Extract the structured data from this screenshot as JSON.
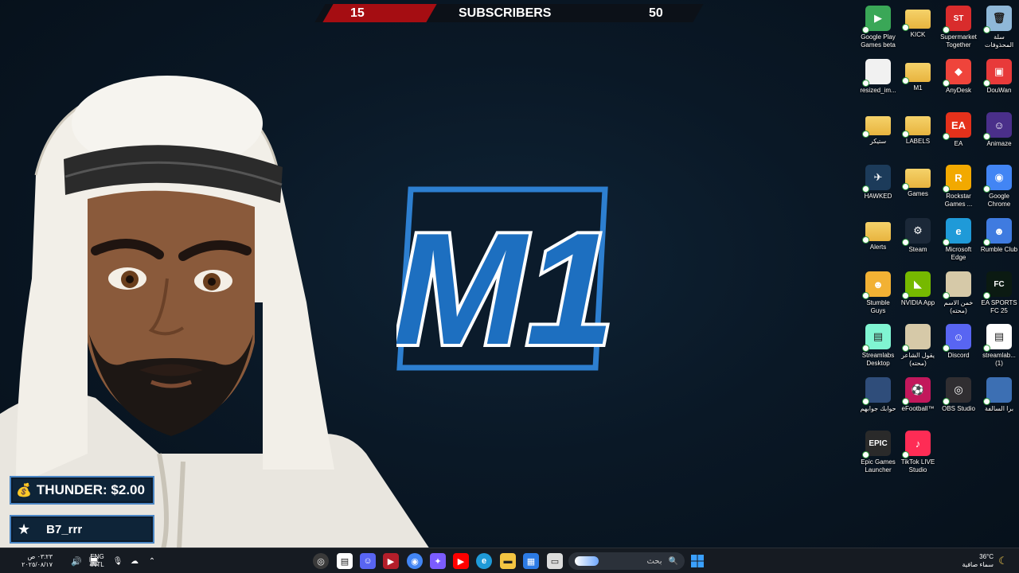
{
  "subscriber_bar": {
    "left_count": "15",
    "label": "SUBSCRIBERS",
    "right_count": "50"
  },
  "logo_text": "M1",
  "donation": {
    "text": "THUNDER: $2.00",
    "icon": "money-bag-icon"
  },
  "follower": {
    "text": "B7_rrr",
    "icon": "star-icon"
  },
  "desktop_icons": [
    {
      "label": "Google Play Games beta",
      "icon": "google-play-games-icon",
      "color": "#3aa757"
    },
    {
      "label": "KICK",
      "icon": "folder-icon",
      "color": "#e8b43f"
    },
    {
      "label": "Supermarket Together",
      "icon": "supermarket-together-icon",
      "color": "#d92c2c"
    },
    {
      "label": "سلة المحذوفات",
      "icon": "recycle-bin-icon",
      "color": "#8fb8d8"
    },
    {
      "label": "resized_im...",
      "icon": "image-file-icon",
      "color": "#f1f1f1"
    },
    {
      "label": "M1",
      "icon": "folder-icon",
      "color": "#e8b43f"
    },
    {
      "label": "AnyDesk",
      "icon": "anydesk-icon",
      "color": "#ef443b"
    },
    {
      "label": "DouWan",
      "icon": "douwan-icon",
      "color": "#e83a3a"
    },
    {
      "label": "ستيكر",
      "icon": "folder-icon",
      "color": "#e8b43f"
    },
    {
      "label": "LABELS",
      "icon": "folder-icon",
      "color": "#e8b43f"
    },
    {
      "label": "EA",
      "icon": "ea-icon",
      "color": "#e5311b"
    },
    {
      "label": "Animaze",
      "icon": "animaze-icon",
      "color": "#4a2f8a"
    },
    {
      "label": "HAWKED",
      "icon": "hawked-icon",
      "color": "#1c3b5a"
    },
    {
      "label": "Games",
      "icon": "folder-icon",
      "color": "#e8b43f"
    },
    {
      "label": "Rockstar Games ...",
      "icon": "rockstar-icon",
      "color": "#f2a900"
    },
    {
      "label": "Google Chrome",
      "icon": "chrome-icon",
      "color": "#4285f4"
    },
    {
      "label": "Alerts",
      "icon": "folder-icon",
      "color": "#e8b43f"
    },
    {
      "label": "Steam",
      "icon": "steam-icon",
      "color": "#1b2838"
    },
    {
      "label": "Microsoft Edge",
      "icon": "edge-icon",
      "color": "#1f9ad8"
    },
    {
      "label": "Rumble Club",
      "icon": "rumble-club-icon",
      "color": "#3f7be0"
    },
    {
      "label": "Stumble Guys",
      "icon": "stumble-guys-icon",
      "color": "#f2b134"
    },
    {
      "label": "NVIDIA App",
      "icon": "nvidia-icon",
      "color": "#76b900"
    },
    {
      "label": "خمن الاسم (محته)",
      "icon": "image-file-icon",
      "color": "#d6c9a8"
    },
    {
      "label": "EA SPORTS FC 25",
      "icon": "fc25-icon",
      "color": "#0b1a12"
    },
    {
      "label": "Streamlabs Desktop",
      "icon": "streamlabs-icon",
      "color": "#80f5d2"
    },
    {
      "label": "يقول الشاعر (محته)",
      "icon": "image-file-icon",
      "color": "#d6c9a8"
    },
    {
      "label": "Discord",
      "icon": "discord-icon",
      "color": "#5865f2"
    },
    {
      "label": "streamlab... (1)",
      "icon": "streamlabs-icon",
      "color": "#ffffff"
    },
    {
      "label": "حوابك جوابهم",
      "icon": "image-file-icon",
      "color": "#2f4d7a"
    },
    {
      "label": "eFootball™",
      "icon": "efootball-icon",
      "color": "#c2185b"
    },
    {
      "label": "OBS Studio",
      "icon": "obs-icon",
      "color": "#302e31"
    },
    {
      "label": "برا السالفة",
      "icon": "image-file-icon",
      "color": "#3c6fb3"
    },
    {
      "label": "Epic Games Launcher",
      "icon": "epic-games-icon",
      "color": "#2a2a2a"
    },
    {
      "label": "TikTok LIVE Studio",
      "icon": "tiktok-icon",
      "color": "#fe2c55"
    }
  ],
  "taskbar": {
    "clock_time": "٠٣:٢٣ ص",
    "clock_date": "٢٠٢٥/٠٨/١٧",
    "language": "ENG",
    "layout": "INTL",
    "search_placeholder": "بحث",
    "weather_temp": "36°C",
    "weather_desc": "سماء صافية",
    "pinned": [
      {
        "icon": "obs-taskbar-icon",
        "color": "#3a3a3a"
      },
      {
        "icon": "streamlabs-taskbar-icon",
        "color": "#ffffff"
      },
      {
        "icon": "discord-taskbar-icon",
        "color": "#5865f2"
      },
      {
        "icon": "video-app-icon",
        "color": "#b31e2a"
      },
      {
        "icon": "chrome-taskbar-icon",
        "color": "#4285f4"
      },
      {
        "icon": "copilot-icon",
        "color": "#7b5cff"
      },
      {
        "icon": "youtube-icon",
        "color": "#ff0000"
      },
      {
        "icon": "edge-taskbar-icon",
        "color": "#1f9ad8"
      },
      {
        "icon": "file-explorer-icon",
        "color": "#f4c542"
      },
      {
        "icon": "store-icon",
        "color": "#2c7be5"
      },
      {
        "icon": "task-view-icon",
        "color": "#dcdcdc"
      }
    ]
  }
}
